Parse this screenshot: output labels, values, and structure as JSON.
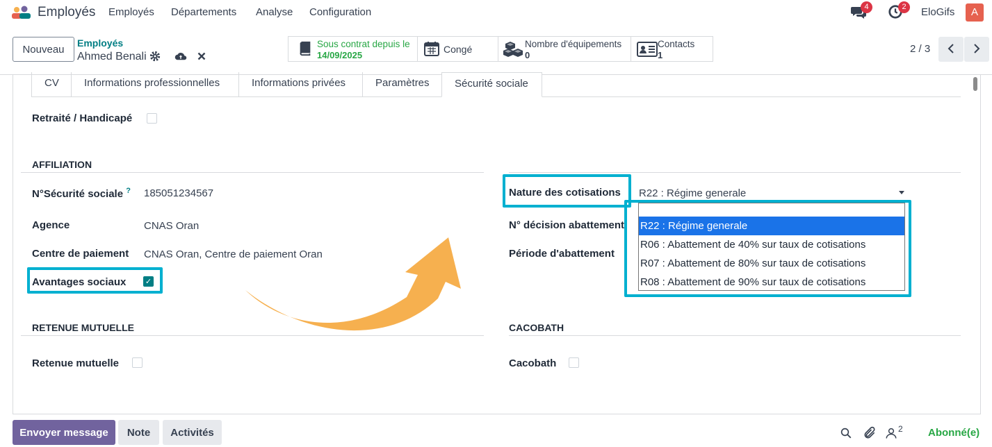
{
  "navbar": {
    "app_title": "Employés",
    "menu": [
      "Employés",
      "Départements",
      "Analyse",
      "Configuration"
    ],
    "messages_count": "4",
    "activities_count": "2",
    "company": "EloGifs",
    "avatar_letter": "A"
  },
  "control_panel": {
    "new_button": "Nouveau",
    "breadcrumb_parent": "Employés",
    "breadcrumb_current": "Ahmed Benali",
    "pager": "2 / 3",
    "smart_buttons": {
      "contract_label": "Sous contrat depuis le",
      "contract_value": "14/09/2025",
      "leave_label": "Congé",
      "equipment_label": "Nombre d'équipements",
      "equipment_value": "0",
      "contacts_label": "Contacts",
      "contacts_value": "1"
    }
  },
  "tabs": [
    "CV",
    "Informations professionnelles",
    "Informations privées",
    "Paramètres",
    "Sécurité sociale"
  ],
  "form": {
    "retired_label": "Retraité / Handicapé",
    "affiliation_title": "AFFILIATION",
    "ssn_label": "N°Sécurité sociale",
    "ssn_help": "?",
    "ssn_value": "185051234567",
    "agency_label": "Agence",
    "agency_value": "CNAS Oran",
    "payment_center_label": "Centre de paiement",
    "payment_center_value": "CNAS Oran, Centre de paiement Oran",
    "social_benefits_label": "Avantages sociaux",
    "social_benefits_checked": true,
    "contribution_label": "Nature des cotisations",
    "contribution_value": "R22 : Régime generale",
    "decision_label": "N° décision abattement",
    "period_label": "Période d'abattement",
    "contribution_options": [
      "R22 : Régime generale",
      "R06 : Abattement de 40% sur taux de cotisations",
      "R07 : Abattement de 80% sur taux de cotisations",
      "R08 : Abattement de 90% sur taux de cotisations"
    ],
    "mutual_title": "RETENUE MUTUELLE",
    "mutual_label": "Retenue mutuelle",
    "cacobath_title": "CACOBATH",
    "cacobath_label": "Cacobath"
  },
  "chatter": {
    "send_message": "Envoyer message",
    "note": "Note",
    "activities": "Activités",
    "followers_count": "2",
    "follow_status": "Abonné(e)"
  },
  "colors": {
    "accent_teal": "#017e84",
    "highlight": "#00b0d0",
    "arrow": "#f6b04f",
    "primary_button": "#71639e",
    "selected_option": "#1a73e8"
  }
}
